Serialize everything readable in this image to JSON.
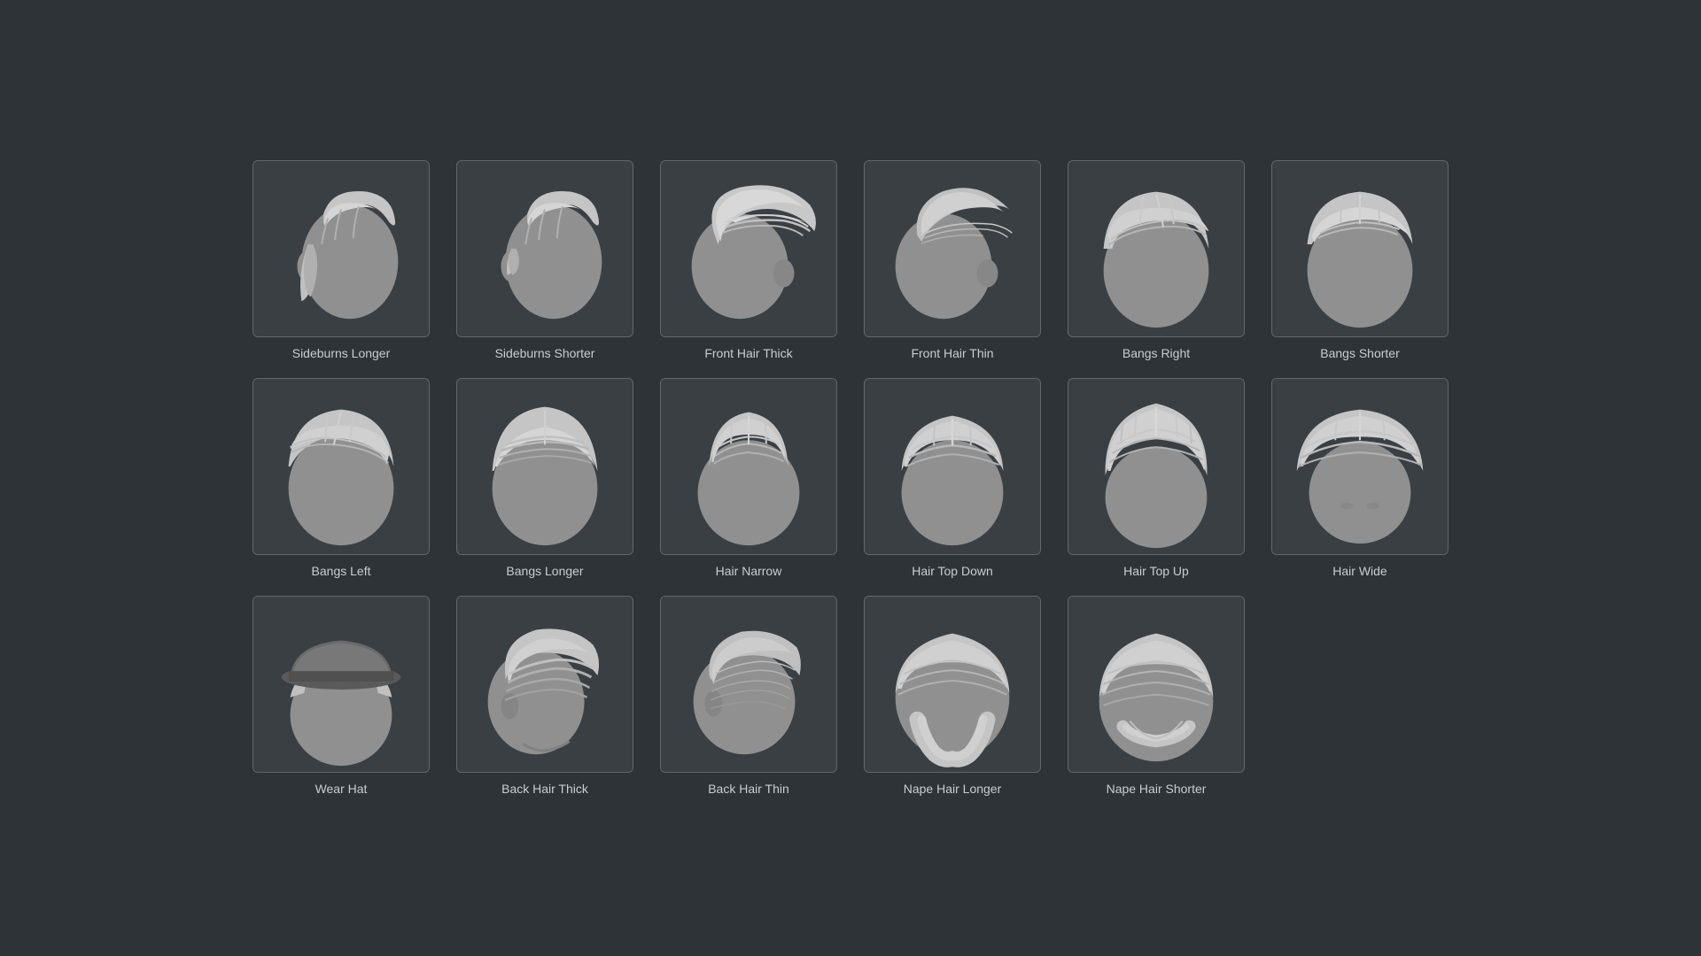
{
  "items": [
    {
      "id": "sideburns-longer",
      "label": "Sideburns Longer",
      "row": 1,
      "col": 1
    },
    {
      "id": "sideburns-shorter",
      "label": "Sideburns Shorter",
      "row": 1,
      "col": 2
    },
    {
      "id": "front-hair-thick",
      "label": "Front Hair Thick",
      "row": 1,
      "col": 3
    },
    {
      "id": "front-hair-thin",
      "label": "Front Hair Thin",
      "row": 1,
      "col": 4
    },
    {
      "id": "bangs-right",
      "label": "Bangs Right",
      "row": 1,
      "col": 5
    },
    {
      "id": "bangs-shorter",
      "label": "Bangs Shorter",
      "row": 1,
      "col": 6
    },
    {
      "id": "bangs-left",
      "label": "Bangs Left",
      "row": 2,
      "col": 1
    },
    {
      "id": "bangs-longer",
      "label": "Bangs Longer",
      "row": 2,
      "col": 2
    },
    {
      "id": "hair-narrow",
      "label": "Hair Narrow",
      "row": 2,
      "col": 3
    },
    {
      "id": "hair-top-down",
      "label": "Hair Top Down",
      "row": 2,
      "col": 4
    },
    {
      "id": "hair-top-up",
      "label": "Hair Top Up",
      "row": 2,
      "col": 5
    },
    {
      "id": "hair-wide",
      "label": "Hair Wide",
      "row": 2,
      "col": 6
    },
    {
      "id": "wear-hat",
      "label": "Wear Hat",
      "row": 3,
      "col": 1
    },
    {
      "id": "back-hair-thick",
      "label": "Back Hair Thick",
      "row": 3,
      "col": 2
    },
    {
      "id": "back-hair-thin",
      "label": "Back Hair Thin",
      "row": 3,
      "col": 3
    },
    {
      "id": "nape-hair-longer",
      "label": "Nape Hair Longer",
      "row": 3,
      "col": 4
    },
    {
      "id": "nape-hair-shorter",
      "label": "Nape Hair Shorter",
      "row": 3,
      "col": 5
    }
  ],
  "colors": {
    "background": "#2e3338",
    "box_border": "#666666",
    "box_bg": "#3a3f44",
    "label_color": "#c8cdd2",
    "hair_light": "#d0d0d0",
    "hair_mid": "#a8a8a8",
    "hair_dark": "#888888",
    "skin_light": "#b0b0b0",
    "skin_mid": "#909090"
  }
}
